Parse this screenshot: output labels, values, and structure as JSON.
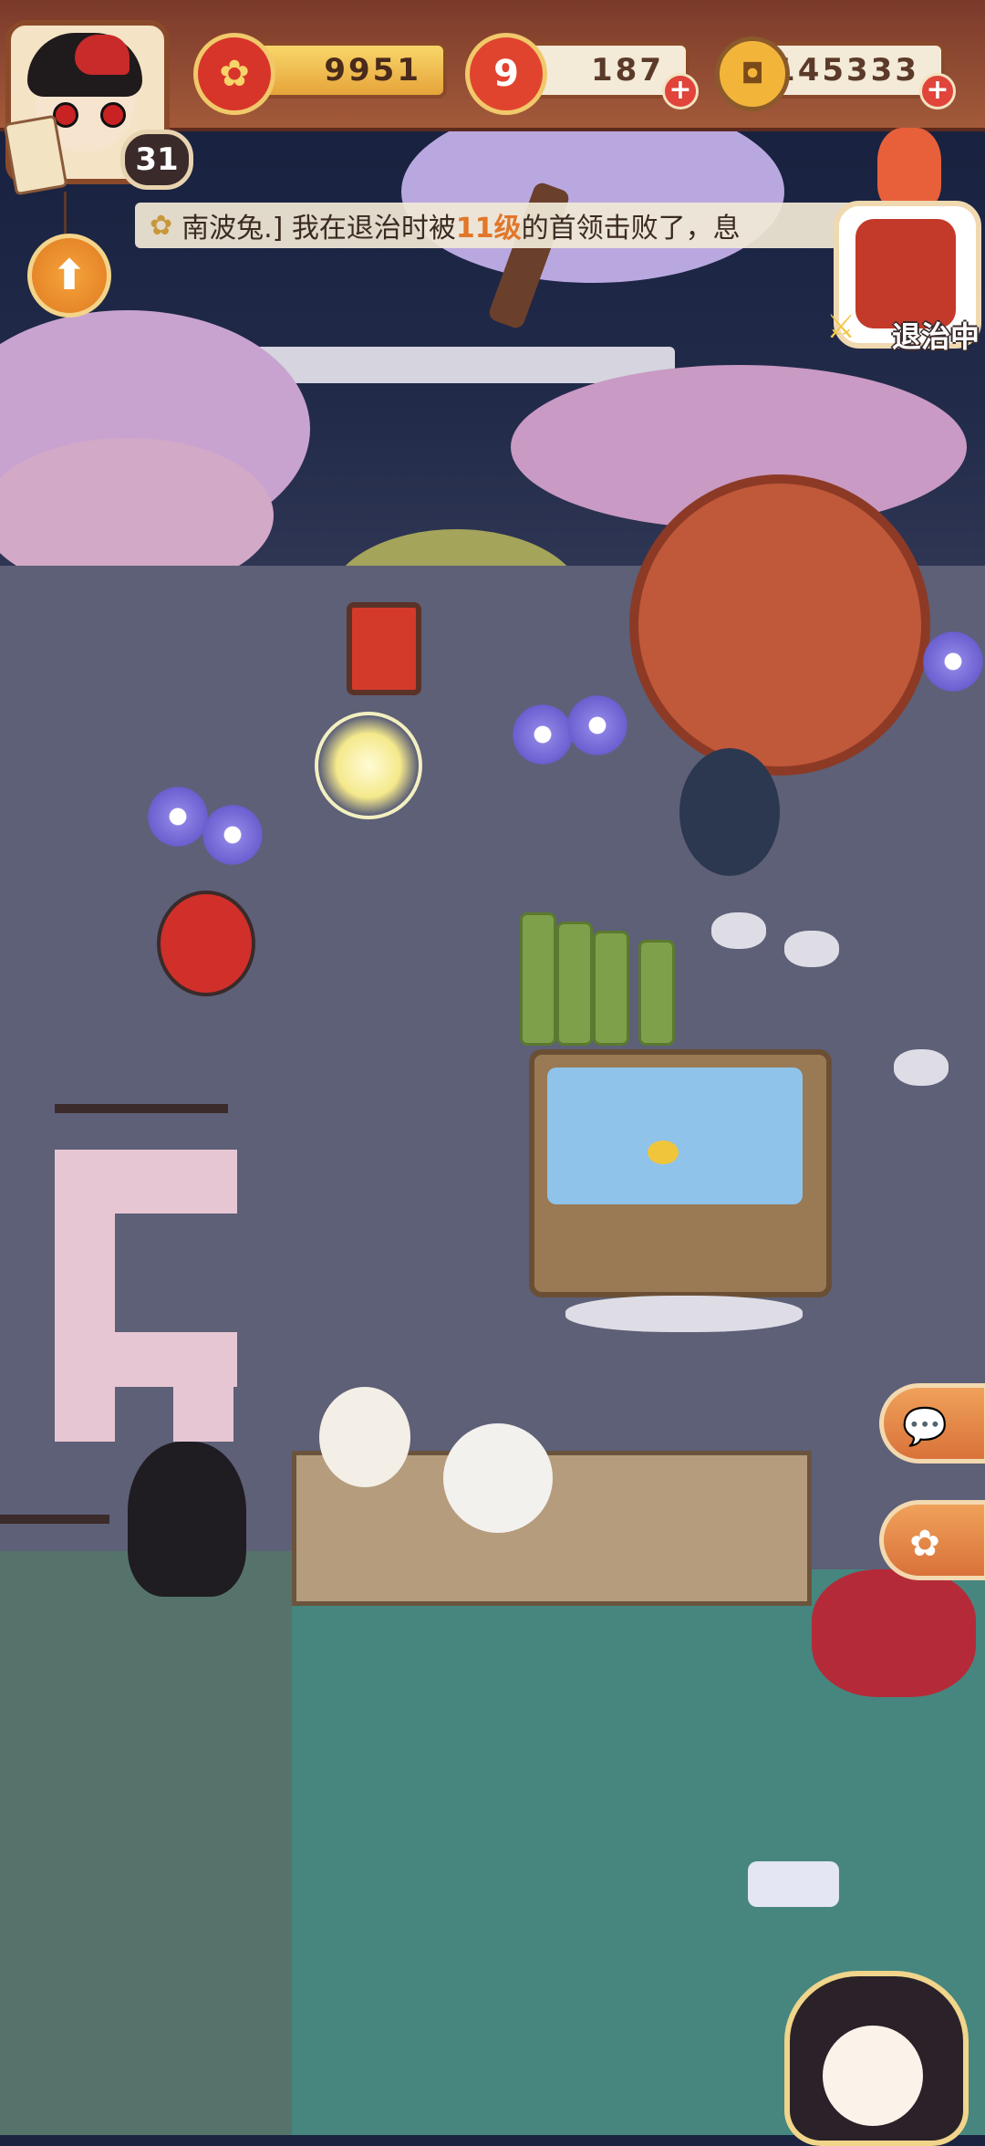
{
  "player": {
    "level": "31"
  },
  "resources": {
    "gold": "9951",
    "stamina": "187",
    "coins": "145333",
    "stamina_icon_glyph": "9",
    "plus_label": "+"
  },
  "ticker": {
    "prefix": "南波兔.] 我在退治时被",
    "highlight": "11级",
    "suffix": "的首领击败了，息"
  },
  "boss": {
    "status_label": "退治中"
  },
  "icons": {
    "level_up": "arrow-up-icon",
    "chat": "chat-bubble-icon",
    "gift": "gift-icon",
    "gold": "red-flower-gold-icon",
    "stamina": "stamina-icon",
    "coin": "coin-icon"
  },
  "colors": {
    "hud_brown": "#a35a3a",
    "gold_bar": "#f8d66a",
    "highlight_orange": "#e0772a",
    "pond": "#46867f",
    "ground": "#5d6077"
  }
}
